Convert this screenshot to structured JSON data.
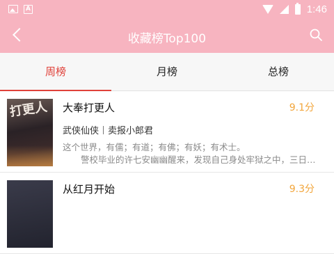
{
  "status_bar": {
    "time": "1:46",
    "icons": [
      "image-icon",
      "a-icon",
      "wifi-icon",
      "signal-icon",
      "battery-icon"
    ]
  },
  "header": {
    "title": "收藏榜Top100",
    "background_color": "#f7b4c0"
  },
  "tabs": [
    {
      "label": "周榜",
      "active": true
    },
    {
      "label": "月榜",
      "active": false
    },
    {
      "label": "总榜",
      "active": false
    }
  ],
  "books": [
    {
      "cover_text": "打更人",
      "title": "大奉打更人",
      "score": "9.1分",
      "category": "武侠仙侠",
      "author": "卖报小郎君",
      "desc_line1": "这个世界，有儒；有道；有佛；有妖；有术士。",
      "desc_line2": "警校毕业的许七安幽幽醒来，发现自己身处牢狱之中，三日后流..."
    },
    {
      "title": "从红月开始",
      "score": "9.3分"
    }
  ],
  "colors": {
    "accent": "#e0413a",
    "score": "#f2a53a"
  }
}
